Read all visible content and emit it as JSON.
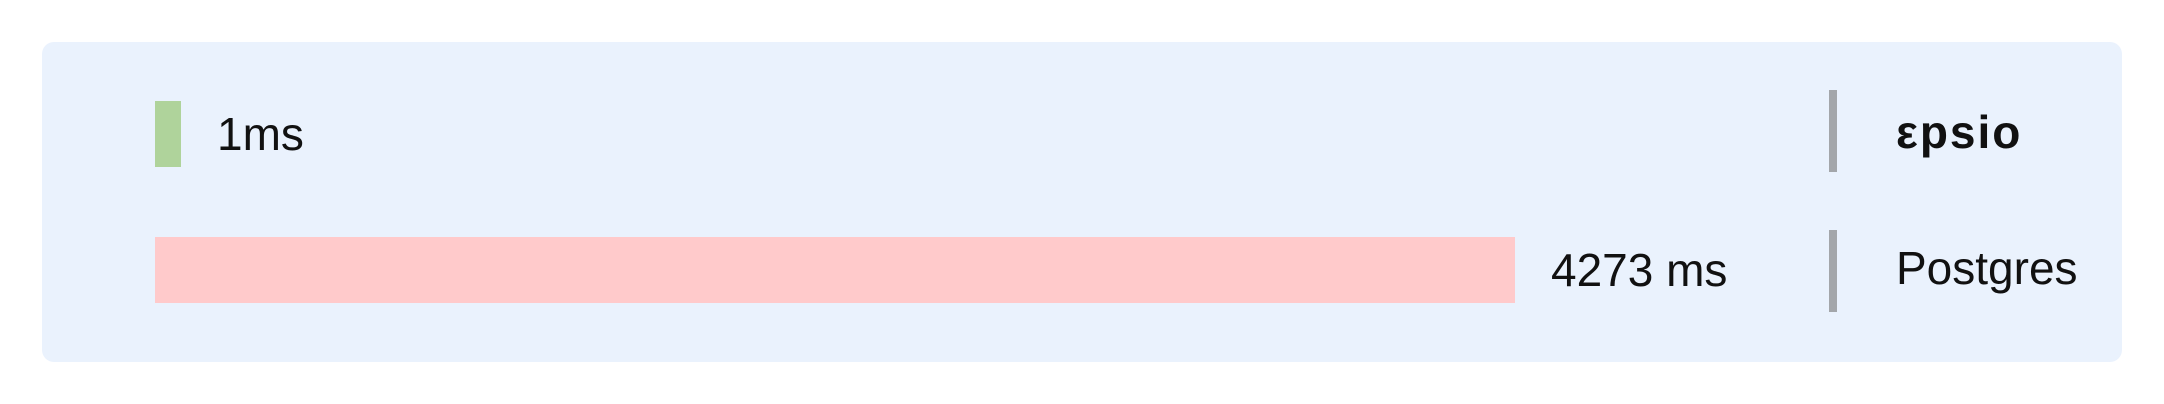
{
  "chart_data": {
    "type": "bar",
    "orientation": "horizontal",
    "categories": [
      "εpsio",
      "Postgres"
    ],
    "values": [
      1,
      4273
    ],
    "value_labels": [
      "1ms",
      "4273 ms"
    ],
    "colors": [
      "#afd39b",
      "#ffcacb"
    ],
    "xlim": [
      0,
      4273
    ],
    "grid": false
  },
  "colors": {
    "panel_background": "#eaf2fd",
    "divider": "#a3a6aa"
  }
}
